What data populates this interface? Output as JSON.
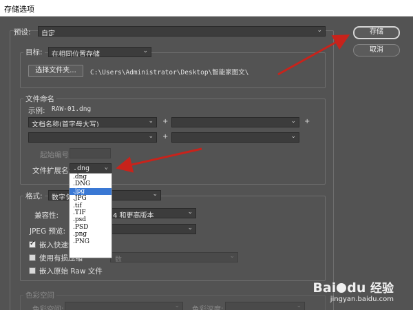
{
  "window": {
    "title": "存储选项"
  },
  "buttons": {
    "save": "存储",
    "cancel": "取消"
  },
  "preset": {
    "label": "预设:",
    "value": "自定"
  },
  "destination": {
    "label": "目标:",
    "value": "在相同位置存储",
    "choose_button": "选择文件夹...",
    "path": "C:\\Users\\Administrator\\Desktop\\智能家图文\\"
  },
  "file_naming": {
    "group_title": "文件命名",
    "example_label": "示例:",
    "example_value": "RAW-01.dng",
    "field1": "文档名称(首字母大写)",
    "plus": "+",
    "start_number_label": "起始编号:",
    "extension_label": "文件扩展名:",
    "extension_value": ".dng",
    "extension_options": [
      ".dng",
      ".DNG",
      ".jpg",
      ".JPG",
      ".tif",
      ".TIF",
      ".psd",
      ".PSD",
      ".png",
      ".PNG"
    ],
    "extension_selected_index": 2
  },
  "format": {
    "group_title": "格式:",
    "format_value": "数字负",
    "compat_label": "兼容性:",
    "compat_value": "4 和更高版本",
    "jpeg_preview_label": "JPEG 预览:",
    "embed_fast_load_label": "嵌入快速载",
    "embed_fast_load_checked": true,
    "lossy_label": "使用有损压缩",
    "lossy_value": "数",
    "lossy_checked": false,
    "embed_raw_label": "嵌入原始 Raw 文件",
    "embed_raw_checked": false
  },
  "color_space": {
    "group_title": "色彩空间",
    "space_label": "色彩空间:",
    "depth_label": "色彩深度:"
  },
  "watermark": {
    "brand": "Bai",
    "paw": "du",
    "jingyan": "经验",
    "url": "jingyan.baidu.com"
  }
}
